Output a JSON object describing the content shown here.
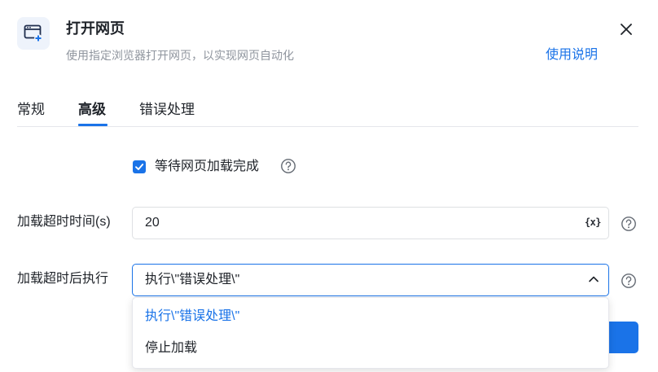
{
  "header": {
    "title": "打开网页",
    "subtitle": "使用指定浏览器打开网页，以实现网页自动化",
    "help_link": "使用说明",
    "icon": "browser-add-icon",
    "close_icon": "close-icon"
  },
  "tabs": [
    {
      "label": "常规",
      "active": false
    },
    {
      "label": "高级",
      "active": true
    },
    {
      "label": "错误处理",
      "active": false
    }
  ],
  "form": {
    "wait_checkbox": {
      "label": "等待网页加载完成",
      "checked": true
    },
    "timeout": {
      "label": "加载超时时间(s)",
      "value": "20",
      "var_icon": "{x}"
    },
    "on_timeout": {
      "label": "加载超时后执行",
      "selected": "执行\\\"错误处理\\\"",
      "options": [
        "执行\\\"错误处理\\\"",
        "停止加载"
      ]
    }
  },
  "colors": {
    "accent": "#1a73e8",
    "text": "#1f2329",
    "muted": "#8f959e",
    "border": "#dee0e3"
  }
}
